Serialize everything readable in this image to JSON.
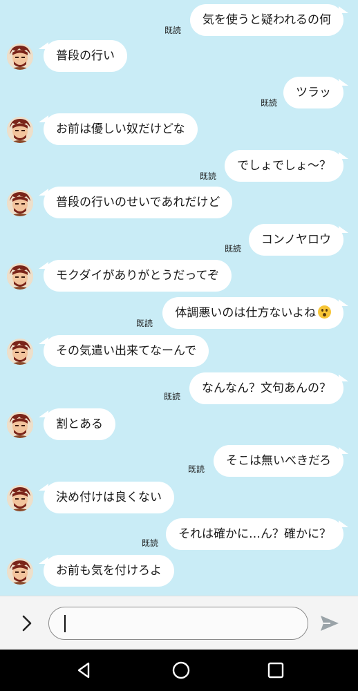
{
  "read_label": "既読",
  "colors": {
    "background": "#c9ecf6",
    "bubble": "#ffffff",
    "send_icon": "#9aa3a8"
  },
  "messages": [
    {
      "side": "out",
      "text": "気を使うと疑われるの何",
      "read": true
    },
    {
      "side": "in",
      "text": "普段の行い"
    },
    {
      "side": "out",
      "text": "ツラッ",
      "read": true
    },
    {
      "side": "in",
      "text": "お前は優しい奴だけどな"
    },
    {
      "side": "out",
      "text": "でしょでしょ〜？",
      "read": true
    },
    {
      "side": "in",
      "text": "普段の行いのせいであれだけど"
    },
    {
      "side": "out",
      "text": "コンノヤロウ",
      "read": true
    },
    {
      "side": "in",
      "text": "モクダイがありがとうだってぞ"
    },
    {
      "side": "out",
      "text": "体調悪いのは仕方ないよね",
      "emoji": "astonished-face",
      "read": true
    },
    {
      "side": "in",
      "text": "その気遣い出来てなーんで"
    },
    {
      "side": "out",
      "text": "なんなん？文句あんの？",
      "read": true
    },
    {
      "side": "in",
      "text": "割とある"
    },
    {
      "side": "out",
      "text": "そこは無いべきだろ",
      "read": true
    },
    {
      "side": "in",
      "text": "決め付けは良くない"
    },
    {
      "side": "out",
      "text": "それは確かに…ん？確かに？",
      "read": true
    },
    {
      "side": "in",
      "text": "お前も気を付けろよ"
    }
  ],
  "input": {
    "value": "",
    "placeholder": ""
  },
  "icons": {
    "expand": "chevron-right-icon",
    "send": "send-icon",
    "nav": [
      "back-triangle-icon",
      "home-circle-icon",
      "recent-apps-square-icon"
    ]
  }
}
